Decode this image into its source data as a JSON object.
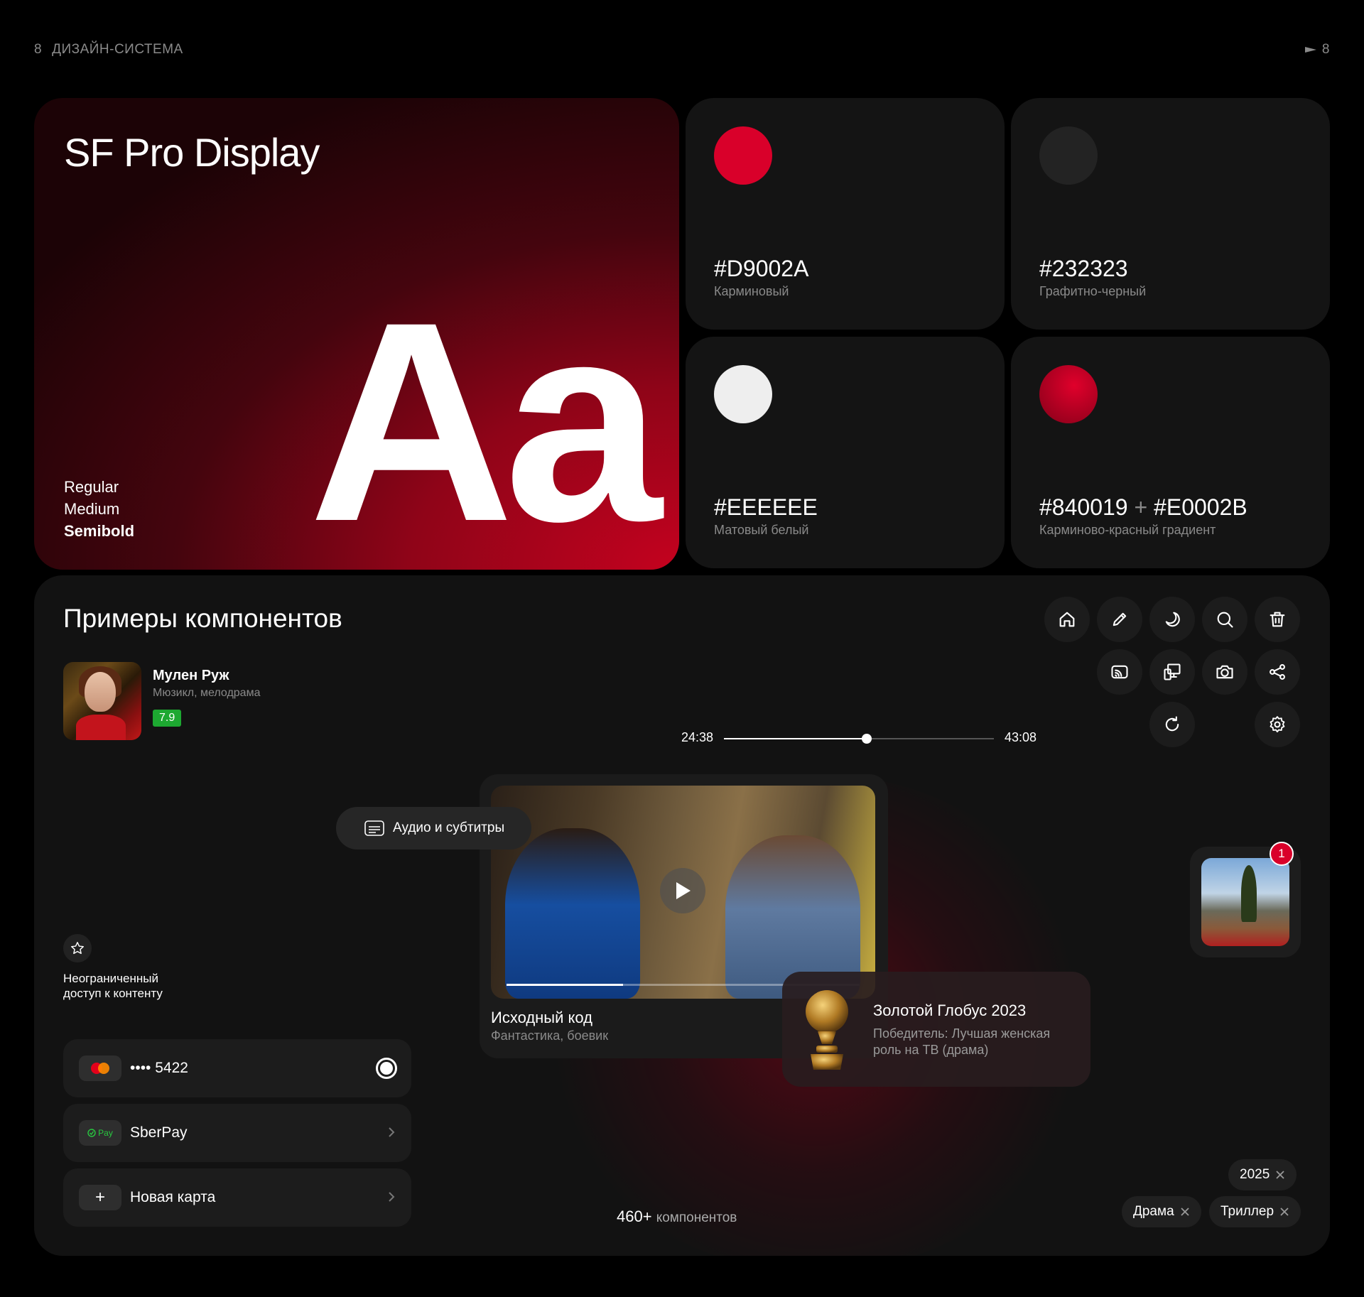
{
  "header": {
    "page_num": "8",
    "section": "ДИЗАЙН-СИСТЕМА",
    "right_num": "8"
  },
  "typography": {
    "font_name": "SF Pro Display",
    "weights": [
      "Regular",
      "Medium",
      "Semibold"
    ],
    "sample": "Aa"
  },
  "colors": [
    {
      "hex": "#D9002A",
      "name": "Карминовый",
      "swatch": "#d9002a"
    },
    {
      "hex": "#232323",
      "name": "Графитно-черный",
      "swatch": "#232323"
    },
    {
      "hex": "#EEEEEE",
      "name": "Матовый белый",
      "swatch": "#eeeeee"
    },
    {
      "hex_a": "#840019",
      "plus": "+",
      "hex_b": "#E0002B",
      "name": "Карминово-красный градиент",
      "swatch_from": "#840019",
      "swatch_to": "#e0002b"
    }
  ],
  "components": {
    "title": "Примеры компонентов",
    "movie": {
      "title": "Мулен Руж",
      "genre": "Мюзикл, мелодрама",
      "rating": "7.9"
    },
    "icons": [
      "home-icon",
      "edit-icon",
      "moon-icon",
      "search-icon",
      "trash-icon",
      "cast-icon",
      "devices-icon",
      "camera-icon",
      "share-icon",
      "refresh-icon",
      "settings-icon"
    ],
    "player": {
      "current": "24:38",
      "total": "43:08",
      "progress": 0.53
    },
    "audio_pill": "Аудио и субтитры",
    "video": {
      "title": "Исходный код",
      "genre": "Фантастика, боевик",
      "progress": 0.33
    },
    "award": {
      "title": "Золотой Глобус 2023",
      "desc": "Победитель: Лучшая женская роль на ТВ (драма)"
    },
    "notification_badge": "1",
    "feature": {
      "text": "Неограниченный доступ к контенту"
    },
    "payments": {
      "card": "•••• 5422",
      "sberpay": "SberPay",
      "sberpay_icon": "Pay",
      "new_card": "Новая карта",
      "new_card_icon": "+"
    },
    "count": {
      "number": "460+",
      "label": "компонентов"
    },
    "chips": {
      "year": "2025",
      "genre1": "Драма",
      "genre2": "Триллер"
    },
    "accent": "#d9002a",
    "rating_color": "#1da831"
  }
}
